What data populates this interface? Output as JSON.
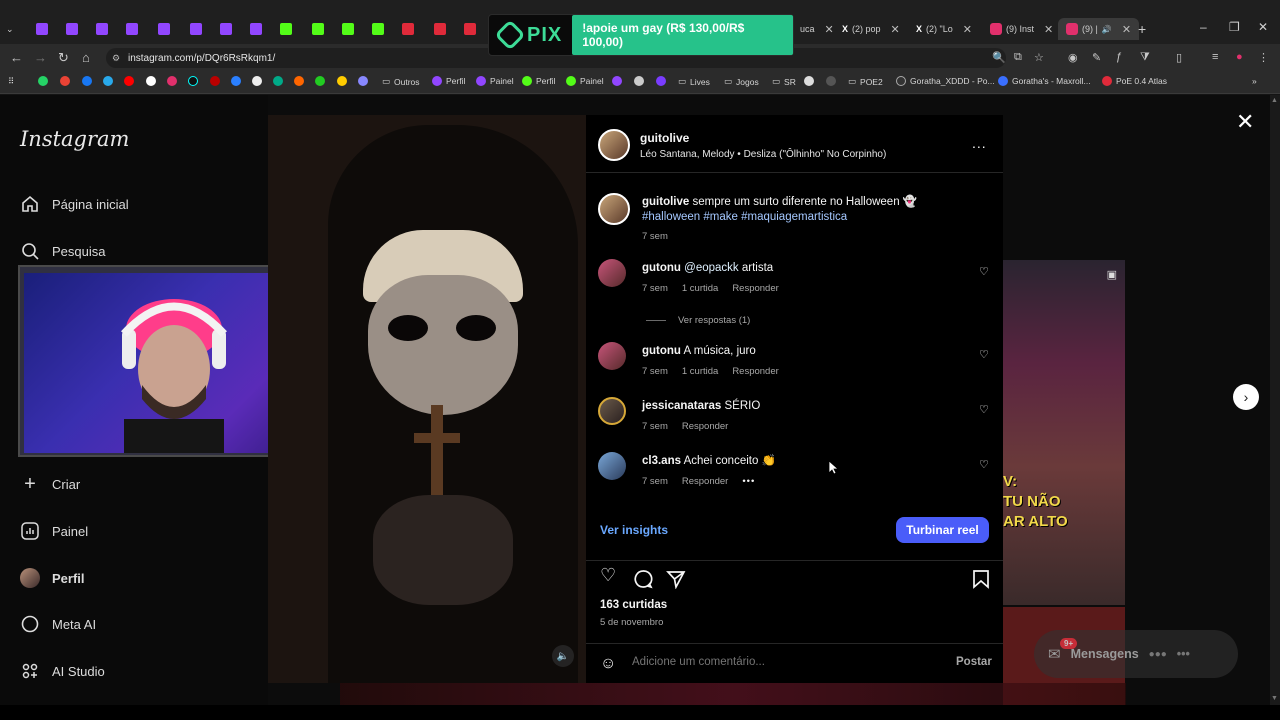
{
  "browser": {
    "tabs": [
      {
        "label": "(2) pop",
        "icon_color": "#ffffff"
      },
      {
        "label": "(2) \"Lo",
        "icon_color": "#ffffff"
      },
      {
        "label": "(9) Inst",
        "icon_color": "#e1306c"
      },
      {
        "label": "(9) |",
        "icon_color": "#e1306c",
        "active": true
      }
    ],
    "url": "instagram.com/p/DQr6RsRkqm1/",
    "bookmarks": [
      "Outros",
      "Perfil",
      "Painel",
      "Perfil",
      "Painel",
      "Lives",
      "Jogos",
      "SR",
      "POE2",
      "Goratha_XDDD - Po...",
      "Goratha's - Maxroll...",
      "PoE 0.4 Atlas"
    ]
  },
  "pix": {
    "logo": "PIX",
    "message": "!apoie um gay (R$ 130,00/R$ 100,00)",
    "accent": "#26c28a"
  },
  "sidebar": {
    "logo": "Instagram",
    "items": [
      {
        "label": "Página inicial",
        "icon": "home-icon"
      },
      {
        "label": "Pesquisa",
        "icon": "search-icon"
      },
      {
        "label": "Criar",
        "icon": "plus-icon"
      },
      {
        "label": "Painel",
        "icon": "chart-icon"
      },
      {
        "label": "Perfil",
        "icon": "profile-icon"
      },
      {
        "label": "Meta AI",
        "icon": "meta-ai-icon"
      },
      {
        "label": "AI Studio",
        "icon": "ai-studio-icon"
      }
    ]
  },
  "post": {
    "username": "guitolive",
    "music": "Léo Santana, Melody • Desliza (\"Ôlhinho\" No Corpinho)",
    "caption_user": "guitolive",
    "caption_text": "sempre um surto diferente no Halloween 👻",
    "caption_tags": "#halloween #make #maquiagemartistica",
    "caption_time": "7 sem",
    "comments": [
      {
        "user": "gutonu",
        "mention": "@eopackk",
        "text": "artista",
        "time": "7 sem",
        "likes": "1 curtida",
        "reply": "Responder"
      },
      {
        "user": "gutonu",
        "mention": "",
        "text": "A música, juro",
        "time": "7 sem",
        "likes": "1 curtida",
        "reply": "Responder"
      },
      {
        "user": "jessicanataras",
        "mention": "",
        "text": "SÉRIO",
        "time": "7 sem",
        "likes": "",
        "reply": "Responder"
      },
      {
        "user": "cl3.ans",
        "mention": "",
        "text": "Achei conceito 👏",
        "time": "7 sem",
        "likes": "",
        "reply": "Responder"
      }
    ],
    "view_replies": "Ver respostas (1)",
    "insights": "Ver insights",
    "boost": "Turbinar reel",
    "like_count": "163 curtidas",
    "date": "5 de novembro",
    "comment_placeholder": "Adicione um comentário...",
    "post_button": "Postar",
    "more": "..."
  },
  "right_overlay_text": "V:\nTU NÃO\nAR ALTO",
  "messages": {
    "label": "Mensagens",
    "badge": "9+"
  },
  "colors": {
    "accent_blue": "#4a5df9",
    "link_blue": "#6aa8ff",
    "background": "#000000"
  }
}
